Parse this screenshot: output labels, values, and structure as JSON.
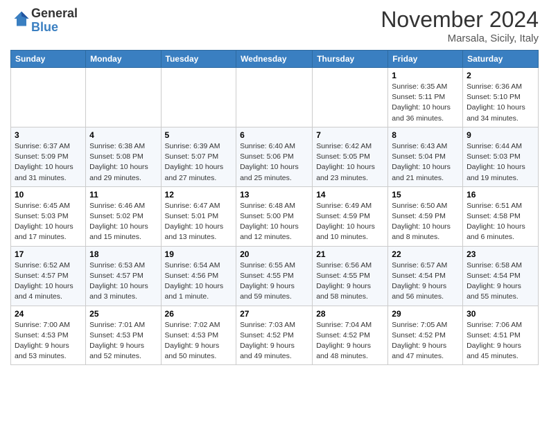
{
  "logo": {
    "general": "General",
    "blue": "Blue"
  },
  "header": {
    "month": "November 2024",
    "location": "Marsala, Sicily, Italy"
  },
  "weekdays": [
    "Sunday",
    "Monday",
    "Tuesday",
    "Wednesday",
    "Thursday",
    "Friday",
    "Saturday"
  ],
  "weeks": [
    [
      {
        "day": "",
        "info": ""
      },
      {
        "day": "",
        "info": ""
      },
      {
        "day": "",
        "info": ""
      },
      {
        "day": "",
        "info": ""
      },
      {
        "day": "",
        "info": ""
      },
      {
        "day": "1",
        "info": "Sunrise: 6:35 AM\nSunset: 5:11 PM\nDaylight: 10 hours\nand 36 minutes."
      },
      {
        "day": "2",
        "info": "Sunrise: 6:36 AM\nSunset: 5:10 PM\nDaylight: 10 hours\nand 34 minutes."
      }
    ],
    [
      {
        "day": "3",
        "info": "Sunrise: 6:37 AM\nSunset: 5:09 PM\nDaylight: 10 hours\nand 31 minutes."
      },
      {
        "day": "4",
        "info": "Sunrise: 6:38 AM\nSunset: 5:08 PM\nDaylight: 10 hours\nand 29 minutes."
      },
      {
        "day": "5",
        "info": "Sunrise: 6:39 AM\nSunset: 5:07 PM\nDaylight: 10 hours\nand 27 minutes."
      },
      {
        "day": "6",
        "info": "Sunrise: 6:40 AM\nSunset: 5:06 PM\nDaylight: 10 hours\nand 25 minutes."
      },
      {
        "day": "7",
        "info": "Sunrise: 6:42 AM\nSunset: 5:05 PM\nDaylight: 10 hours\nand 23 minutes."
      },
      {
        "day": "8",
        "info": "Sunrise: 6:43 AM\nSunset: 5:04 PM\nDaylight: 10 hours\nand 21 minutes."
      },
      {
        "day": "9",
        "info": "Sunrise: 6:44 AM\nSunset: 5:03 PM\nDaylight: 10 hours\nand 19 minutes."
      }
    ],
    [
      {
        "day": "10",
        "info": "Sunrise: 6:45 AM\nSunset: 5:03 PM\nDaylight: 10 hours\nand 17 minutes."
      },
      {
        "day": "11",
        "info": "Sunrise: 6:46 AM\nSunset: 5:02 PM\nDaylight: 10 hours\nand 15 minutes."
      },
      {
        "day": "12",
        "info": "Sunrise: 6:47 AM\nSunset: 5:01 PM\nDaylight: 10 hours\nand 13 minutes."
      },
      {
        "day": "13",
        "info": "Sunrise: 6:48 AM\nSunset: 5:00 PM\nDaylight: 10 hours\nand 12 minutes."
      },
      {
        "day": "14",
        "info": "Sunrise: 6:49 AM\nSunset: 4:59 PM\nDaylight: 10 hours\nand 10 minutes."
      },
      {
        "day": "15",
        "info": "Sunrise: 6:50 AM\nSunset: 4:59 PM\nDaylight: 10 hours\nand 8 minutes."
      },
      {
        "day": "16",
        "info": "Sunrise: 6:51 AM\nSunset: 4:58 PM\nDaylight: 10 hours\nand 6 minutes."
      }
    ],
    [
      {
        "day": "17",
        "info": "Sunrise: 6:52 AM\nSunset: 4:57 PM\nDaylight: 10 hours\nand 4 minutes."
      },
      {
        "day": "18",
        "info": "Sunrise: 6:53 AM\nSunset: 4:57 PM\nDaylight: 10 hours\nand 3 minutes."
      },
      {
        "day": "19",
        "info": "Sunrise: 6:54 AM\nSunset: 4:56 PM\nDaylight: 10 hours\nand 1 minute."
      },
      {
        "day": "20",
        "info": "Sunrise: 6:55 AM\nSunset: 4:55 PM\nDaylight: 9 hours\nand 59 minutes."
      },
      {
        "day": "21",
        "info": "Sunrise: 6:56 AM\nSunset: 4:55 PM\nDaylight: 9 hours\nand 58 minutes."
      },
      {
        "day": "22",
        "info": "Sunrise: 6:57 AM\nSunset: 4:54 PM\nDaylight: 9 hours\nand 56 minutes."
      },
      {
        "day": "23",
        "info": "Sunrise: 6:58 AM\nSunset: 4:54 PM\nDaylight: 9 hours\nand 55 minutes."
      }
    ],
    [
      {
        "day": "24",
        "info": "Sunrise: 7:00 AM\nSunset: 4:53 PM\nDaylight: 9 hours\nand 53 minutes."
      },
      {
        "day": "25",
        "info": "Sunrise: 7:01 AM\nSunset: 4:53 PM\nDaylight: 9 hours\nand 52 minutes."
      },
      {
        "day": "26",
        "info": "Sunrise: 7:02 AM\nSunset: 4:53 PM\nDaylight: 9 hours\nand 50 minutes."
      },
      {
        "day": "27",
        "info": "Sunrise: 7:03 AM\nSunset: 4:52 PM\nDaylight: 9 hours\nand 49 minutes."
      },
      {
        "day": "28",
        "info": "Sunrise: 7:04 AM\nSunset: 4:52 PM\nDaylight: 9 hours\nand 48 minutes."
      },
      {
        "day": "29",
        "info": "Sunrise: 7:05 AM\nSunset: 4:52 PM\nDaylight: 9 hours\nand 47 minutes."
      },
      {
        "day": "30",
        "info": "Sunrise: 7:06 AM\nSunset: 4:51 PM\nDaylight: 9 hours\nand 45 minutes."
      }
    ]
  ]
}
